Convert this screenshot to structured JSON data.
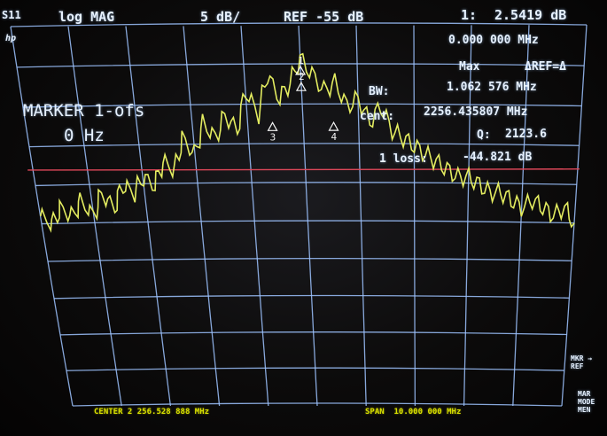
{
  "header": {
    "channel": "S11",
    "format": "log MAG",
    "scale": "5 dB/",
    "reference": "REF -55 dB",
    "marker_id": "1:",
    "marker_value": "2.5419 dB"
  },
  "logo": "hp",
  "marker_readout": {
    "offset_freq": "0.000 000 MHz",
    "mode": "Max",
    "ref_label": "ΔREF=Δ",
    "bw_label": "BW:",
    "bw_value": "1.062 576 MHz",
    "cent_label": "cent:",
    "cent_value": "2256.435807 MHz",
    "q_label": "Q:",
    "q_value": "2123.6",
    "loss_label": "1 loss:",
    "loss_value": "-44.821 dB"
  },
  "marker_panel": {
    "title": "MARKER 1-ofs",
    "value": "0 Hz"
  },
  "markers": [
    {
      "label": "1",
      "x": 0.0
    },
    {
      "label": "2",
      "x": 0.0
    },
    {
      "label": "3",
      "x": -0.55
    },
    {
      "label": "4",
      "x": 0.55
    }
  ],
  "footer": {
    "center": "CENTER 2 256.528 888 MHz",
    "span": "SPAN  10.000 000 MHz"
  },
  "softkeys": {
    "mkr_ref": "MKR → REF",
    "mar_mode": "MAR MODE MEN"
  },
  "colors": {
    "grid": "#9ec3ff",
    "trace": "#e3ec60",
    "ref_line": "#e0485a",
    "text": "#e6f1ff"
  },
  "chart_data": {
    "type": "line",
    "title": "",
    "xlabel": "",
    "ylabel": "",
    "xlim": [
      2251.528888,
      2261.528888
    ],
    "ylim": [
      -105,
      -55
    ],
    "reference_level": -73,
    "grid": true,
    "series": [
      {
        "x": [
          2251.53,
          2251.73,
          2251.93,
          2252.13,
          2252.33,
          2252.53,
          2252.73,
          2252.93,
          2253.13,
          2253.33,
          2253.53,
          2253.73,
          2253.93,
          2254.13,
          2254.33,
          2254.53,
          2254.73,
          2254.93,
          2255.13,
          2255.33,
          2255.53,
          2255.73,
          2255.93,
          2256.13,
          2256.33,
          2256.53,
          2256.73,
          2256.93,
          2257.13,
          2257.33,
          2257.53,
          2257.73,
          2257.93,
          2258.13,
          2258.33,
          2258.53,
          2258.73,
          2258.93,
          2259.13,
          2259.33,
          2259.53,
          2259.73,
          2259.93,
          2260.13,
          2260.33,
          2260.53,
          2260.73,
          2260.93,
          2261.13,
          2261.33,
          2261.53
        ],
        "y": [
          -79,
          -80,
          -78,
          -79,
          -77,
          -79,
          -76,
          -78,
          -75,
          -76,
          -74,
          -75,
          -72,
          -73,
          -69,
          -71,
          -67,
          -69,
          -66,
          -68,
          -63,
          -66,
          -61,
          -64,
          -62,
          -59,
          -61,
          -63,
          -62,
          -65,
          -64,
          -67,
          -65,
          -68,
          -69,
          -70,
          -71,
          -72,
          -73,
          -74,
          -74,
          -75,
          -76,
          -76,
          -77,
          -78,
          -77,
          -78,
          -79,
          -78,
          -80
        ]
      }
    ]
  }
}
